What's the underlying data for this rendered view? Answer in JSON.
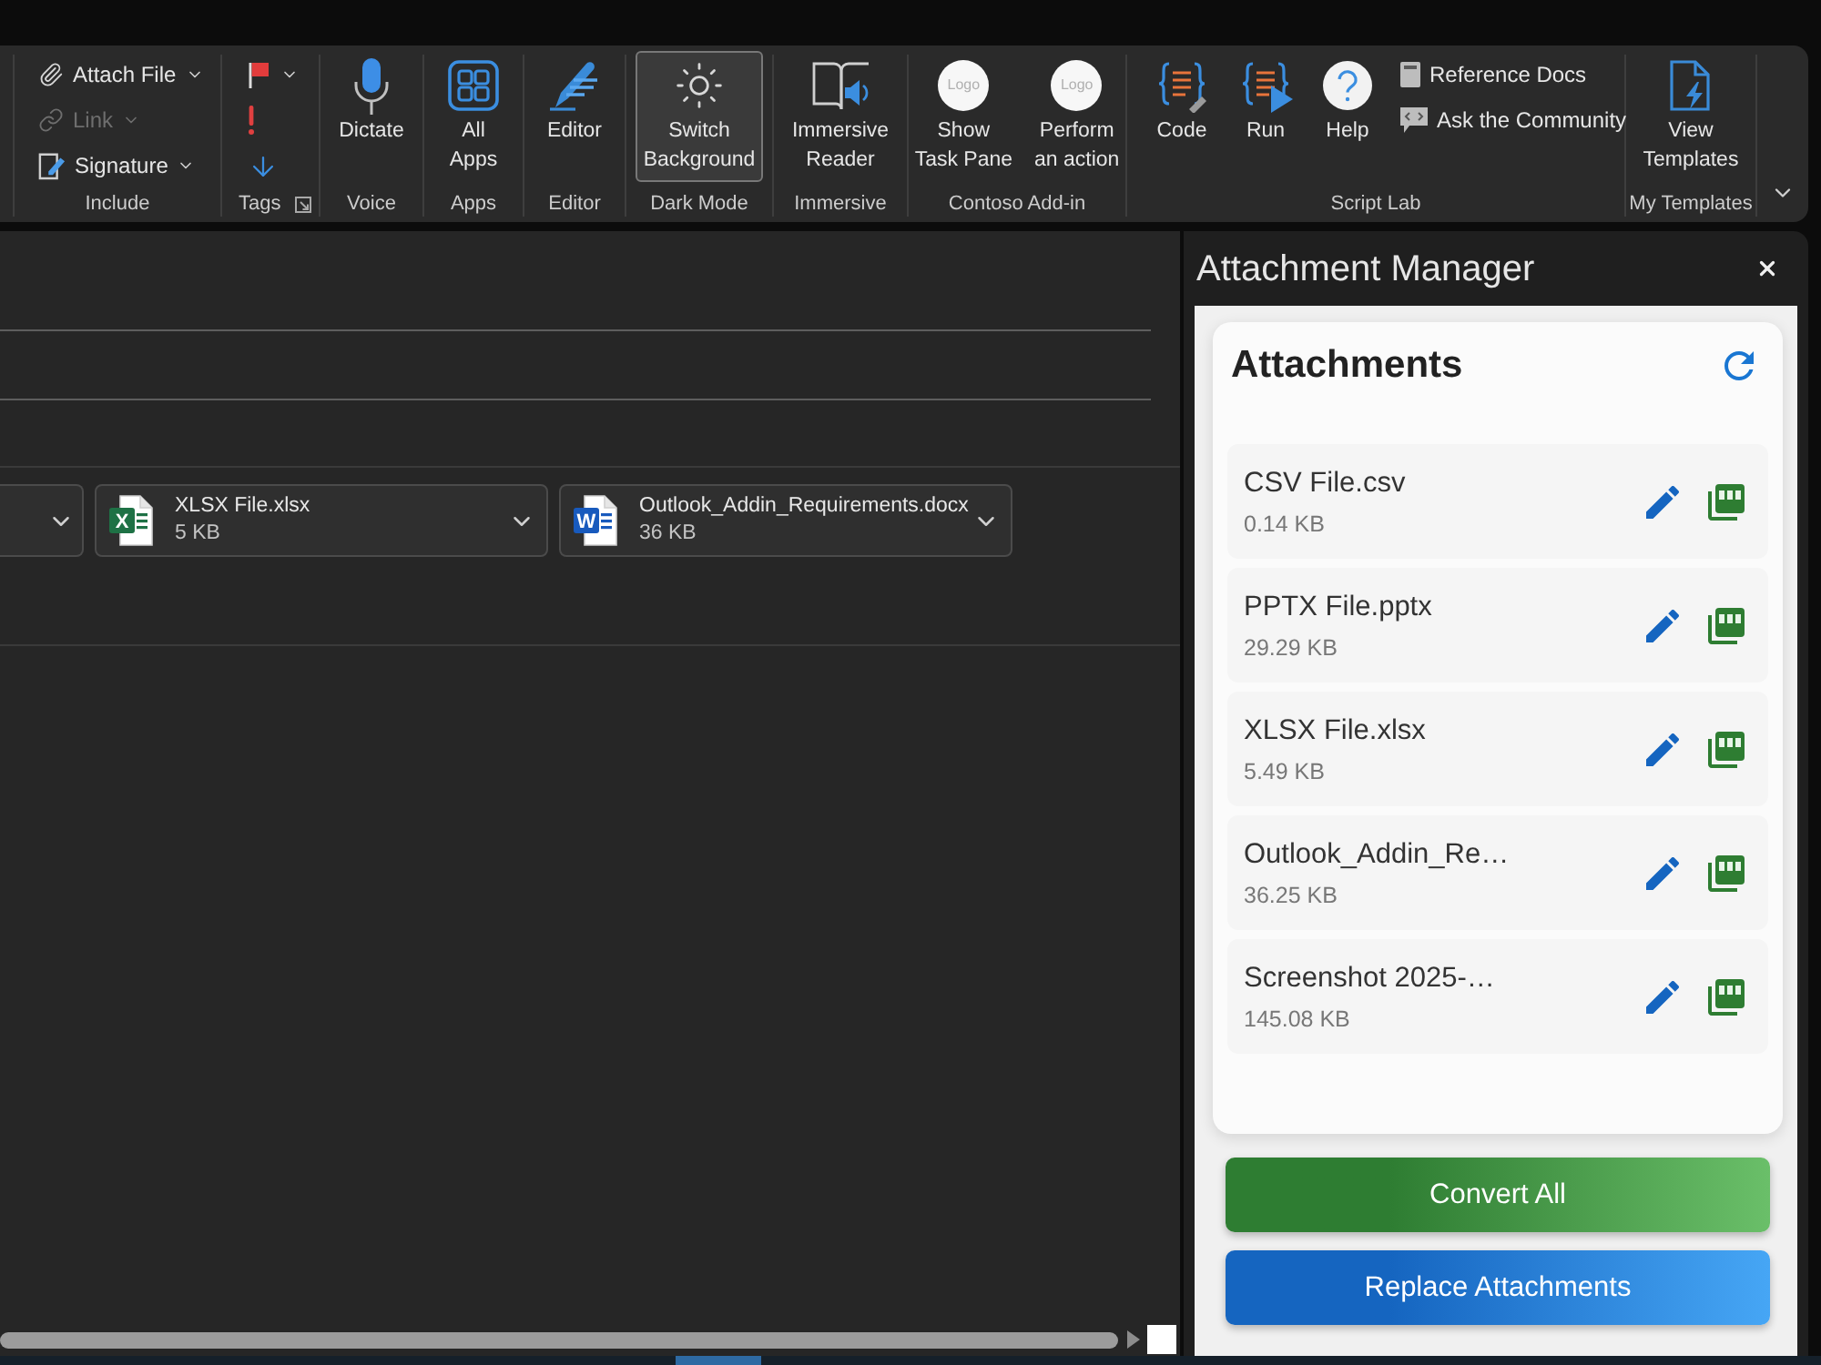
{
  "ribbon": {
    "groups": [
      {
        "label": "Include",
        "items": [
          {
            "kind": "small",
            "label": "Attach File",
            "dropdown": true,
            "disabled": false,
            "pressed": false
          },
          {
            "kind": "small",
            "label": "Link",
            "dropdown": true,
            "disabled": true,
            "pressed": false
          },
          {
            "kind": "small",
            "label": "Signature",
            "dropdown": true,
            "disabled": false,
            "pressed": false
          }
        ]
      },
      {
        "label": "Tags",
        "launcher": true,
        "items": [
          {
            "kind": "icon",
            "dropdown": true,
            "pressed": false
          },
          {
            "kind": "icon",
            "dropdown": false,
            "pressed": false
          },
          {
            "kind": "icon",
            "dropdown": false,
            "pressed": false
          }
        ]
      },
      {
        "label": "Voice",
        "items": [
          {
            "kind": "large",
            "lines": [
              "Dictate"
            ],
            "pressed": false
          }
        ]
      },
      {
        "label": "Apps",
        "items": [
          {
            "kind": "large",
            "lines": [
              "All",
              "Apps"
            ],
            "pressed": false
          }
        ]
      },
      {
        "label": "Editor",
        "items": [
          {
            "kind": "large",
            "lines": [
              "Editor"
            ],
            "pressed": false
          }
        ]
      },
      {
        "label": "Dark Mode",
        "items": [
          {
            "kind": "large",
            "lines": [
              "Switch",
              "Background"
            ],
            "pressed": true
          }
        ]
      },
      {
        "label": "Immersive",
        "items": [
          {
            "kind": "large",
            "lines": [
              "Immersive",
              "Reader"
            ],
            "pressed": false
          }
        ]
      },
      {
        "label": "Contoso Add-in",
        "items": [
          {
            "kind": "large",
            "lines": [
              "Show",
              "Task Pane"
            ],
            "icon_text": "Logo",
            "pressed": false
          },
          {
            "kind": "large",
            "lines": [
              "Perform",
              "an action"
            ],
            "icon_text": "Logo",
            "pressed": false
          }
        ]
      },
      {
        "label": "Script Lab",
        "items": [
          {
            "kind": "large",
            "lines": [
              "Code"
            ],
            "pressed": false
          },
          {
            "kind": "large",
            "lines": [
              "Run"
            ],
            "pressed": false
          },
          {
            "kind": "large",
            "lines": [
              "Help"
            ],
            "pressed": false
          },
          {
            "kind": "small",
            "label": "Reference Docs",
            "dropdown": false,
            "pressed": false
          },
          {
            "kind": "small",
            "label": "Ask the Community",
            "dropdown": false,
            "pressed": false
          }
        ]
      },
      {
        "label": "My Templates",
        "items": [
          {
            "kind": "large",
            "lines": [
              "View",
              "Templates"
            ],
            "pressed": false
          }
        ]
      }
    ]
  },
  "attachment_chips": [
    {
      "kind": "partial"
    },
    {
      "kind": "file",
      "icon_letter": "X",
      "color": "#1e7145",
      "name": "XLSX File.xlsx",
      "size": "5 KB"
    },
    {
      "kind": "file",
      "icon_letter": "W",
      "color": "#185abd",
      "name": "Outlook_Addin_Requirements.docx",
      "size": "36 KB"
    }
  ],
  "task_pane": {
    "title": "Attachment Manager",
    "card": {
      "title": "Attachments",
      "files": [
        {
          "name": "CSV File.csv",
          "size": "0.14 KB"
        },
        {
          "name": "PPTX File.pptx",
          "size": "29.29 KB"
        },
        {
          "name": "XLSX File.xlsx",
          "size": "5.49 KB"
        },
        {
          "name": "Outlook_Addin_Re…",
          "size": "36.25 KB"
        },
        {
          "name": "Screenshot 2025-…",
          "size": "145.08 KB"
        }
      ]
    },
    "buttons": [
      {
        "kind": "convert",
        "label": "Convert All"
      },
      {
        "kind": "replace",
        "label": "Replace Attachments"
      }
    ]
  }
}
